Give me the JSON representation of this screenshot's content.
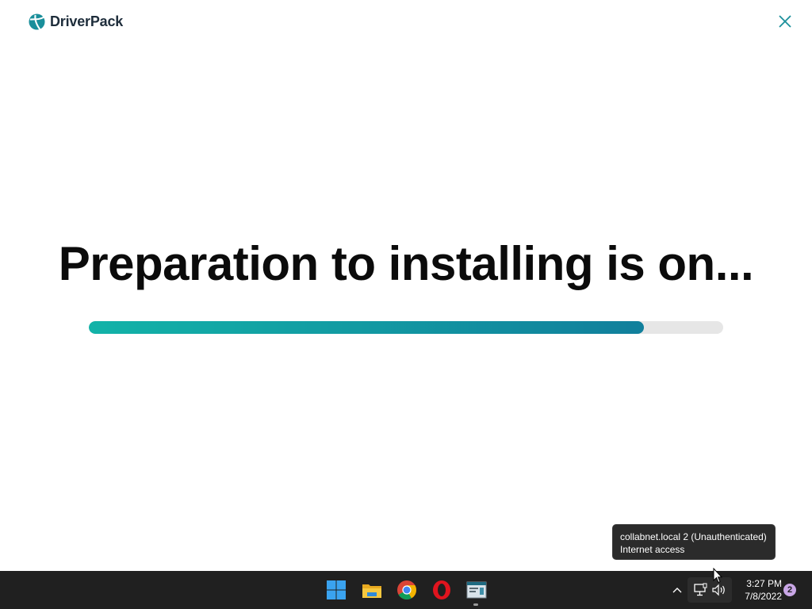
{
  "app": {
    "brand_name": "DriverPack",
    "brand_color": "#1a8f9b",
    "heading": "Preparation to installing is on...",
    "progress_fraction": 0.875,
    "progress_colors": [
      "#12b3a8",
      "#117f9c"
    ]
  },
  "tooltip": {
    "line1": "collabnet.local 2 (Unauthenticated)",
    "line2": "Internet access"
  },
  "taskbar": {
    "pinned": [
      {
        "name": "start-button",
        "icon": "windows-logo-icon"
      },
      {
        "name": "file-explorer-button",
        "icon": "folder-icon"
      },
      {
        "name": "chrome-button",
        "icon": "chrome-icon"
      },
      {
        "name": "opera-button",
        "icon": "opera-icon"
      },
      {
        "name": "driverpack-app-button",
        "icon": "app-window-icon"
      }
    ],
    "tray": {
      "chevron_icon": "chevron-up-icon",
      "network_icon": "network-icon",
      "volume_icon": "volume-icon",
      "time": "3:27 PM",
      "date": "7/8/2022",
      "notification_count": "2"
    }
  }
}
